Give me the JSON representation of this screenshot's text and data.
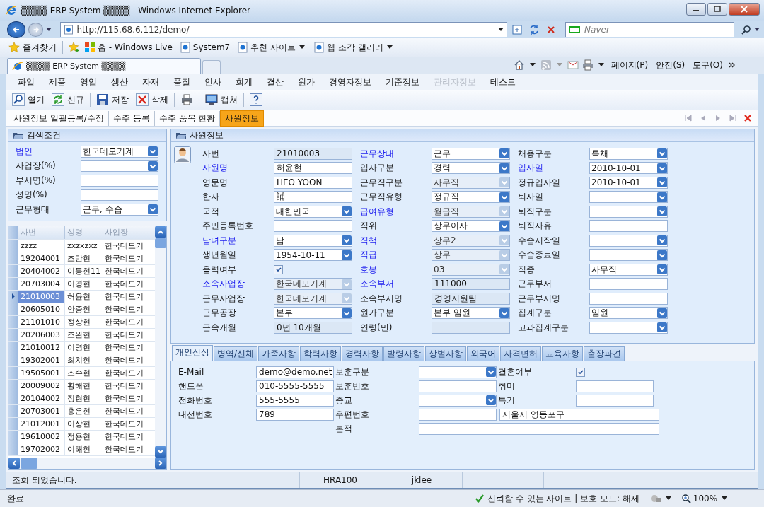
{
  "window": {
    "title": "▒▒▒▒ ERP System ▒▒▒▒ - Windows Internet Explorer"
  },
  "address_bar": {
    "url": "http://115.68.6.112/demo/"
  },
  "search": {
    "placeholder": "Naver"
  },
  "favorites_bar": {
    "favorites": "즐겨찾기",
    "links": [
      {
        "label": "홈 - Windows Live",
        "dropdown": false
      },
      {
        "label": "System7",
        "dropdown": false
      },
      {
        "label": "추천 사이트",
        "dropdown": true
      },
      {
        "label": "웹 조각 갤러리",
        "dropdown": true
      }
    ]
  },
  "browser_tabs": [
    {
      "label": "▒▒▒▒ ERP System ▒▒▒▒",
      "selected": true
    }
  ],
  "command_bar": [
    "페이지(P)",
    "안전(S)",
    "도구(O)"
  ],
  "menu": [
    {
      "label": "파일",
      "disabled": false
    },
    {
      "label": "제품",
      "disabled": false
    },
    {
      "label": "영업",
      "disabled": false
    },
    {
      "label": "생산",
      "disabled": false
    },
    {
      "label": "자재",
      "disabled": false
    },
    {
      "label": "품질",
      "disabled": false
    },
    {
      "label": "인사",
      "disabled": false
    },
    {
      "label": "회계",
      "disabled": false
    },
    {
      "label": "결산",
      "disabled": false
    },
    {
      "label": "원가",
      "disabled": false
    },
    {
      "label": "경영자정보",
      "disabled": false
    },
    {
      "label": "기준정보",
      "disabled": false
    },
    {
      "label": "관리자정보",
      "disabled": true
    },
    {
      "label": "테스트",
      "disabled": false
    }
  ],
  "toolbar": [
    "열기",
    "신규",
    "저장",
    "삭제",
    "캡쳐"
  ],
  "doc_tabs": [
    {
      "label": "사원정보 일괄등록/수정",
      "selected": false
    },
    {
      "label": "수주 등록",
      "selected": false
    },
    {
      "label": "수주 품목 현황",
      "selected": false
    },
    {
      "label": "사원정보",
      "selected": true
    }
  ],
  "search_panel": {
    "title": "검색조건",
    "fields": [
      {
        "label": "법인",
        "required": true,
        "kind": "combo",
        "readonly": false,
        "value": "한국데모기계"
      },
      {
        "label": "사업장(%)",
        "required": false,
        "kind": "combo",
        "readonly": false
      },
      {
        "label": "부서명(%)",
        "required": false,
        "kind": "text",
        "readonly": false
      },
      {
        "label": "성명(%)",
        "required": false,
        "kind": "text",
        "readonly": false
      },
      {
        "label": "근무형태",
        "required": false,
        "kind": "combo",
        "readonly": false,
        "value": "근무, 수습"
      }
    ]
  },
  "employee_grid": {
    "columns": [
      "사번",
      "성명",
      "사업장"
    ],
    "rows": [
      {
        "cells": [
          "zzzz",
          "zxzxzxz",
          "한국데모기"
        ],
        "selected": false
      },
      {
        "cells": [
          "19204001",
          "조만현",
          "한국데모기"
        ],
        "selected": false
      },
      {
        "cells": [
          "20404002",
          "이동현11",
          "한국데모기"
        ],
        "selected": false
      },
      {
        "cells": [
          "20703004",
          "이경현",
          "한국데모기"
        ],
        "selected": false
      },
      {
        "cells": [
          "21010003",
          "허윤현",
          "한국데모기"
        ],
        "selected": true
      },
      {
        "cells": [
          "20605010",
          "안종현",
          "한국데모기"
        ],
        "selected": false
      },
      {
        "cells": [
          "21101010",
          "정상현",
          "한국데모기"
        ],
        "selected": false
      },
      {
        "cells": [
          "20206003",
          "조완현",
          "한국데모기"
        ],
        "selected": false
      },
      {
        "cells": [
          "21010012",
          "이명현",
          "한국데모기"
        ],
        "selected": false
      },
      {
        "cells": [
          "19302001",
          "최치현",
          "한국데모기"
        ],
        "selected": false
      },
      {
        "cells": [
          "19505001",
          "조수현",
          "한국데모기"
        ],
        "selected": false
      },
      {
        "cells": [
          "20009002",
          "황해현",
          "한국데모기"
        ],
        "selected": false
      },
      {
        "cells": [
          "20104002",
          "정현현",
          "한국데모기"
        ],
        "selected": false
      },
      {
        "cells": [
          "20703001",
          "홍은현",
          "한국데모기"
        ],
        "selected": false
      },
      {
        "cells": [
          "21012001",
          "이상현",
          "한국데모기"
        ],
        "selected": false
      },
      {
        "cells": [
          "19610002",
          "정용현",
          "한국데모기"
        ],
        "selected": false
      },
      {
        "cells": [
          "19702002",
          "이해현",
          "한국데모기"
        ],
        "selected": false
      }
    ]
  },
  "employee_panel": {
    "title": "사원정보",
    "columns": [
      [
        {
          "label": "사번",
          "required": false,
          "kind": "text",
          "readonly": true,
          "value": "21010003"
        },
        {
          "label": "사원명",
          "required": true,
          "kind": "text",
          "readonly": false,
          "value": "허윤현"
        },
        {
          "label": "영문명",
          "required": false,
          "kind": "text",
          "readonly": false,
          "value": "HEO YOON"
        },
        {
          "label": "한자",
          "required": false,
          "kind": "text",
          "readonly": false,
          "value": "誧"
        },
        {
          "label": "국적",
          "required": false,
          "kind": "combo",
          "readonly": false,
          "value": "대한민국"
        },
        {
          "label": "주민등록번호",
          "required": false,
          "kind": "text",
          "readonly": false
        },
        {
          "label": "남녀구분",
          "required": true,
          "kind": "combo",
          "readonly": false,
          "value": "남"
        },
        {
          "label": "생년월일",
          "required": false,
          "kind": "combo",
          "readonly": false,
          "value": "1954-10-11"
        },
        {
          "label": "음력여부",
          "required": false,
          "kind": "check",
          "checked": true
        },
        {
          "label": "소속사업장",
          "required": true,
          "kind": "combo",
          "readonly": true,
          "value": "한국데모기계"
        },
        {
          "label": "근무사업장",
          "required": false,
          "kind": "combo",
          "readonly": true,
          "value": "한국데모기계"
        },
        {
          "label": "근무공장",
          "required": false,
          "kind": "combo",
          "readonly": false,
          "value": "본부"
        },
        {
          "label": "근속개월",
          "required": false,
          "kind": "text",
          "readonly": true,
          "value": "0년 10개월"
        }
      ],
      [
        {
          "label": "근무상태",
          "required": true,
          "kind": "combo",
          "readonly": false,
          "value": "근무"
        },
        {
          "label": "입사구분",
          "required": false,
          "kind": "combo",
          "readonly": false,
          "value": "경력"
        },
        {
          "label": "근무직구분",
          "required": false,
          "kind": "combo",
          "readonly": true,
          "value": "사무직"
        },
        {
          "label": "근무직유형",
          "required": false,
          "kind": "combo",
          "readonly": false,
          "value": "정규직"
        },
        {
          "label": "급여유형",
          "required": true,
          "kind": "combo",
          "readonly": true,
          "value": "월급직"
        },
        {
          "label": "직위",
          "required": false,
          "kind": "combo",
          "readonly": false,
          "value": "상무이사"
        },
        {
          "label": "직책",
          "required": true,
          "kind": "combo",
          "readonly": true,
          "value": "상무2"
        },
        {
          "label": "직급",
          "required": true,
          "kind": "combo",
          "readonly": true,
          "value": "상무"
        },
        {
          "label": "호봉",
          "required": true,
          "kind": "combo",
          "readonly": true,
          "value": "03"
        },
        {
          "label": "소속부서",
          "required": true,
          "kind": "text",
          "readonly": true,
          "value": "111000"
        },
        {
          "label": "소속부서명",
          "required": false,
          "kind": "text",
          "readonly": true,
          "value": "경영지원팀"
        },
        {
          "label": "원가구분",
          "required": false,
          "kind": "combo",
          "readonly": false,
          "value": "본부-임원"
        },
        {
          "label": "연령(만)",
          "required": false,
          "kind": "text",
          "readonly": true
        }
      ],
      [
        {
          "label": "채용구분",
          "required": false,
          "kind": "combo",
          "readonly": false,
          "value": "특채"
        },
        {
          "label": "입사일",
          "required": true,
          "kind": "combo",
          "readonly": false,
          "value": "2010-10-01"
        },
        {
          "label": "정규입사일",
          "required": false,
          "kind": "combo",
          "readonly": false,
          "value": "2010-10-01"
        },
        {
          "label": "퇴사일",
          "required": false,
          "kind": "combo",
          "readonly": false
        },
        {
          "label": "퇴직구분",
          "required": false,
          "kind": "combo",
          "readonly": false
        },
        {
          "label": "퇴직사유",
          "required": false,
          "kind": "text",
          "readonly": false
        },
        {
          "label": "수습시작일",
          "required": false,
          "kind": "combo",
          "readonly": false
        },
        {
          "label": "수습종료일",
          "required": false,
          "kind": "combo",
          "readonly": false
        },
        {
          "label": "직종",
          "required": false,
          "kind": "combo",
          "readonly": false,
          "value": "사무직"
        },
        {
          "label": "근무부서",
          "required": false,
          "kind": "text",
          "readonly": false
        },
        {
          "label": "근무부서명",
          "required": false,
          "kind": "text",
          "readonly": false
        },
        {
          "label": "집계구분",
          "required": false,
          "kind": "combo",
          "readonly": false,
          "value": "임원"
        },
        {
          "label": "고과집계구분",
          "required": false,
          "kind": "combo",
          "readonly": false
        }
      ]
    ]
  },
  "detail_tabs": [
    {
      "label": "개인신상",
      "selected": true
    },
    {
      "label": "병역/신체",
      "selected": false
    },
    {
      "label": "가족사항",
      "selected": false
    },
    {
      "label": "학력사항",
      "selected": false
    },
    {
      "label": "경력사항",
      "selected": false
    },
    {
      "label": "발령사항",
      "selected": false
    },
    {
      "label": "상벌사항",
      "selected": false
    },
    {
      "label": "외국어",
      "selected": false
    },
    {
      "label": "자격면허",
      "selected": false
    },
    {
      "label": "교육사항",
      "selected": false
    },
    {
      "label": "출장파견",
      "selected": false
    }
  ],
  "personal_form": {
    "rows": [
      [
        {
          "kind": "text",
          "label": "E-Mail",
          "value": "demo@demo.net"
        },
        {
          "kind": "combo",
          "label": "보훈구분"
        },
        {
          "kind": "check",
          "label": "결혼여부",
          "checked": true
        }
      ],
      [
        {
          "kind": "text",
          "label": "핸드폰",
          "value": "010-5555-5555"
        },
        {
          "kind": "text",
          "label": "보훈번호"
        },
        {
          "kind": "text",
          "label": "취미"
        }
      ],
      [
        {
          "kind": "text",
          "label": "전화번호",
          "value": "555-5555"
        },
        {
          "kind": "combo",
          "label": "종교"
        },
        {
          "kind": "text",
          "label": "특기"
        }
      ],
      [
        {
          "kind": "text",
          "label": "내선번호",
          "value": "789"
        },
        {
          "kind": "text",
          "label": "우편번호"
        },
        {
          "kind": "text",
          "value": "서울시 영등포구"
        }
      ],
      [
        {
          "kind": "blank"
        },
        {
          "kind": "wide",
          "label": "본적"
        }
      ]
    ]
  },
  "status_bar": [
    "조회 되었습니다.",
    "HRA100",
    "jklee"
  ],
  "ie_status": {
    "text": "완료",
    "zone": "신뢰할 수 있는 사이트 | 보호 모드: 해제",
    "zoom": "100%"
  }
}
